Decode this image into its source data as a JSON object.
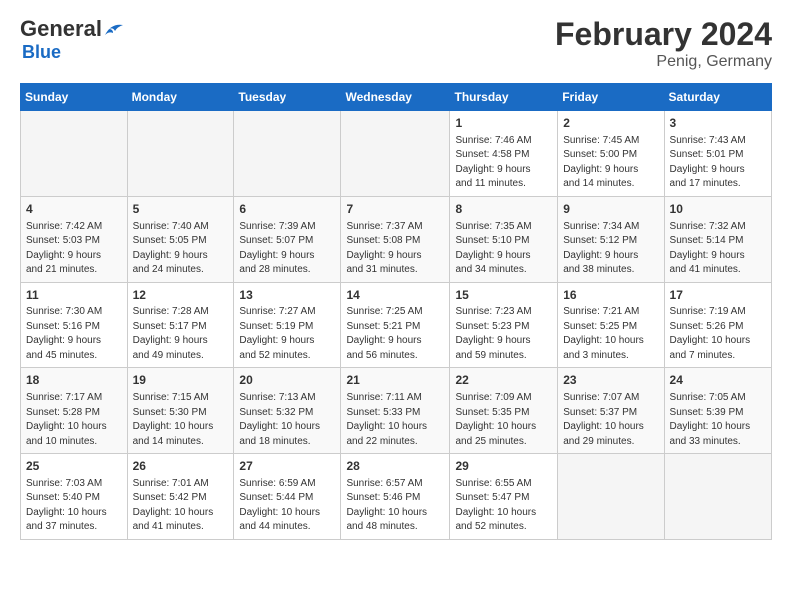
{
  "header": {
    "logo_general": "General",
    "logo_blue": "Blue",
    "month_title": "February 2024",
    "location": "Penig, Germany"
  },
  "days_of_week": [
    "Sunday",
    "Monday",
    "Tuesday",
    "Wednesday",
    "Thursday",
    "Friday",
    "Saturday"
  ],
  "weeks": [
    [
      {
        "day": "",
        "info": ""
      },
      {
        "day": "",
        "info": ""
      },
      {
        "day": "",
        "info": ""
      },
      {
        "day": "",
        "info": ""
      },
      {
        "day": "1",
        "info": "Sunrise: 7:46 AM\nSunset: 4:58 PM\nDaylight: 9 hours\nand 11 minutes."
      },
      {
        "day": "2",
        "info": "Sunrise: 7:45 AM\nSunset: 5:00 PM\nDaylight: 9 hours\nand 14 minutes."
      },
      {
        "day": "3",
        "info": "Sunrise: 7:43 AM\nSunset: 5:01 PM\nDaylight: 9 hours\nand 17 minutes."
      }
    ],
    [
      {
        "day": "4",
        "info": "Sunrise: 7:42 AM\nSunset: 5:03 PM\nDaylight: 9 hours\nand 21 minutes."
      },
      {
        "day": "5",
        "info": "Sunrise: 7:40 AM\nSunset: 5:05 PM\nDaylight: 9 hours\nand 24 minutes."
      },
      {
        "day": "6",
        "info": "Sunrise: 7:39 AM\nSunset: 5:07 PM\nDaylight: 9 hours\nand 28 minutes."
      },
      {
        "day": "7",
        "info": "Sunrise: 7:37 AM\nSunset: 5:08 PM\nDaylight: 9 hours\nand 31 minutes."
      },
      {
        "day": "8",
        "info": "Sunrise: 7:35 AM\nSunset: 5:10 PM\nDaylight: 9 hours\nand 34 minutes."
      },
      {
        "day": "9",
        "info": "Sunrise: 7:34 AM\nSunset: 5:12 PM\nDaylight: 9 hours\nand 38 minutes."
      },
      {
        "day": "10",
        "info": "Sunrise: 7:32 AM\nSunset: 5:14 PM\nDaylight: 9 hours\nand 41 minutes."
      }
    ],
    [
      {
        "day": "11",
        "info": "Sunrise: 7:30 AM\nSunset: 5:16 PM\nDaylight: 9 hours\nand 45 minutes."
      },
      {
        "day": "12",
        "info": "Sunrise: 7:28 AM\nSunset: 5:17 PM\nDaylight: 9 hours\nand 49 minutes."
      },
      {
        "day": "13",
        "info": "Sunrise: 7:27 AM\nSunset: 5:19 PM\nDaylight: 9 hours\nand 52 minutes."
      },
      {
        "day": "14",
        "info": "Sunrise: 7:25 AM\nSunset: 5:21 PM\nDaylight: 9 hours\nand 56 minutes."
      },
      {
        "day": "15",
        "info": "Sunrise: 7:23 AM\nSunset: 5:23 PM\nDaylight: 9 hours\nand 59 minutes."
      },
      {
        "day": "16",
        "info": "Sunrise: 7:21 AM\nSunset: 5:25 PM\nDaylight: 10 hours\nand 3 minutes."
      },
      {
        "day": "17",
        "info": "Sunrise: 7:19 AM\nSunset: 5:26 PM\nDaylight: 10 hours\nand 7 minutes."
      }
    ],
    [
      {
        "day": "18",
        "info": "Sunrise: 7:17 AM\nSunset: 5:28 PM\nDaylight: 10 hours\nand 10 minutes."
      },
      {
        "day": "19",
        "info": "Sunrise: 7:15 AM\nSunset: 5:30 PM\nDaylight: 10 hours\nand 14 minutes."
      },
      {
        "day": "20",
        "info": "Sunrise: 7:13 AM\nSunset: 5:32 PM\nDaylight: 10 hours\nand 18 minutes."
      },
      {
        "day": "21",
        "info": "Sunrise: 7:11 AM\nSunset: 5:33 PM\nDaylight: 10 hours\nand 22 minutes."
      },
      {
        "day": "22",
        "info": "Sunrise: 7:09 AM\nSunset: 5:35 PM\nDaylight: 10 hours\nand 25 minutes."
      },
      {
        "day": "23",
        "info": "Sunrise: 7:07 AM\nSunset: 5:37 PM\nDaylight: 10 hours\nand 29 minutes."
      },
      {
        "day": "24",
        "info": "Sunrise: 7:05 AM\nSunset: 5:39 PM\nDaylight: 10 hours\nand 33 minutes."
      }
    ],
    [
      {
        "day": "25",
        "info": "Sunrise: 7:03 AM\nSunset: 5:40 PM\nDaylight: 10 hours\nand 37 minutes."
      },
      {
        "day": "26",
        "info": "Sunrise: 7:01 AM\nSunset: 5:42 PM\nDaylight: 10 hours\nand 41 minutes."
      },
      {
        "day": "27",
        "info": "Sunrise: 6:59 AM\nSunset: 5:44 PM\nDaylight: 10 hours\nand 44 minutes."
      },
      {
        "day": "28",
        "info": "Sunrise: 6:57 AM\nSunset: 5:46 PM\nDaylight: 10 hours\nand 48 minutes."
      },
      {
        "day": "29",
        "info": "Sunrise: 6:55 AM\nSunset: 5:47 PM\nDaylight: 10 hours\nand 52 minutes."
      },
      {
        "day": "",
        "info": ""
      },
      {
        "day": "",
        "info": ""
      }
    ]
  ]
}
